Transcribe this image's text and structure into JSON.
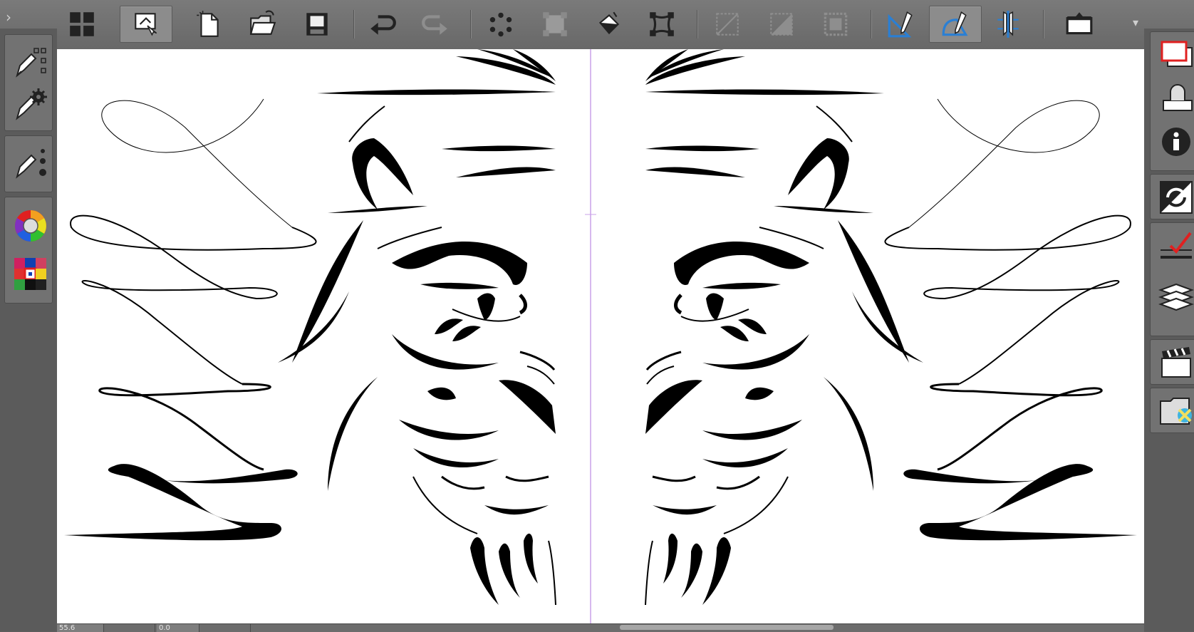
{
  "app": {
    "toolbar_collapse_glyph": "›",
    "toolbar_overflow_glyph": "▾"
  },
  "toolbar": {
    "buttons": [
      {
        "name": "grid-layout-icon",
        "tooltip": ""
      },
      {
        "name": "canvas-fit-icon",
        "tooltip": ""
      },
      {
        "name": "new-file-icon",
        "tooltip": ""
      },
      {
        "name": "open-folder-icon",
        "tooltip": ""
      },
      {
        "name": "save-icon",
        "tooltip": ""
      },
      {
        "name": "undo-icon",
        "tooltip": ""
      },
      {
        "name": "redo-icon",
        "tooltip": ""
      },
      {
        "name": "dot-circle-icon",
        "tooltip": ""
      },
      {
        "name": "transform-disabled-icon",
        "tooltip": ""
      },
      {
        "name": "fill-bucket-icon",
        "tooltip": ""
      },
      {
        "name": "free-transform-icon",
        "tooltip": ""
      },
      {
        "name": "crop-disabled-icon",
        "tooltip": ""
      },
      {
        "name": "half-square-disabled-icon",
        "tooltip": ""
      },
      {
        "name": "selection-grid-icon",
        "tooltip": ""
      },
      {
        "name": "ruler-pen-icon",
        "tooltip": ""
      },
      {
        "name": "curve-ruler-icon",
        "tooltip": ""
      },
      {
        "name": "symmetry-ruler-icon",
        "tooltip": ""
      },
      {
        "name": "fullscreen-toggle-icon",
        "tooltip": ""
      }
    ]
  },
  "left_dock": {
    "tools": [
      "pen-settings-icon",
      "pen-gear-icon",
      "pen-dots-icon",
      "color-wheel-icon",
      "color-palette-icon"
    ]
  },
  "right_dock": {
    "tools": [
      "layer-outline-icon",
      "stamp-icon",
      "info-icon",
      "swap-icon",
      "check-layer-icon",
      "layers-stack-icon",
      "clapper-icon",
      "folder-image-icon"
    ]
  },
  "status": {
    "zoom": "55.6",
    "angle": "0.0"
  },
  "colors": {
    "toolbar_bg": "#707070",
    "dock_bg": "#5b5b5b",
    "accent_blue": "#2a7fd4",
    "accent_red": "#e02020",
    "symmetry_guide": "#c9a0e8"
  }
}
